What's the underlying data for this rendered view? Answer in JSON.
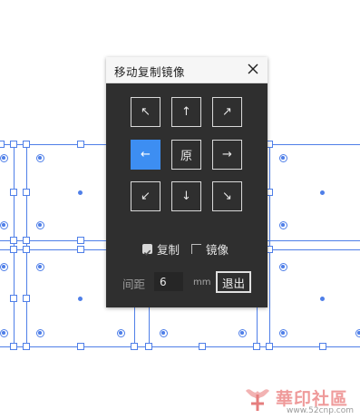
{
  "dialog": {
    "title": "移动复制镜像",
    "close_icon": "close-icon",
    "directions": [
      {
        "id": "up-left",
        "glyph": "↖",
        "icon": "arrow-up-left-icon"
      },
      {
        "id": "up",
        "glyph": "↑",
        "icon": "arrow-up-icon"
      },
      {
        "id": "up-right",
        "glyph": "↗",
        "icon": "arrow-up-right-icon"
      },
      {
        "id": "left",
        "glyph": "←",
        "icon": "arrow-left-icon",
        "active": true
      },
      {
        "id": "origin",
        "label": "原"
      },
      {
        "id": "right",
        "glyph": "→",
        "icon": "arrow-right-icon"
      },
      {
        "id": "down-left",
        "glyph": "↙",
        "icon": "arrow-down-left-icon"
      },
      {
        "id": "down",
        "glyph": "↓",
        "icon": "arrow-down-icon"
      },
      {
        "id": "down-right",
        "glyph": "↘",
        "icon": "arrow-down-right-icon"
      }
    ],
    "copy_label": "复制",
    "copy_checked": true,
    "mirror_label": "镜像",
    "mirror_checked": false,
    "spacing_label": "间距",
    "spacing_value": "6",
    "unit": "mm",
    "exit_label": "退出"
  },
  "colors": {
    "selection": "#4f7fe8",
    "dialog_bg": "#2f2f2f",
    "active_button": "#3d8ef2"
  },
  "watermark": {
    "text": "華印社區",
    "url": "www.52cnp.com"
  }
}
